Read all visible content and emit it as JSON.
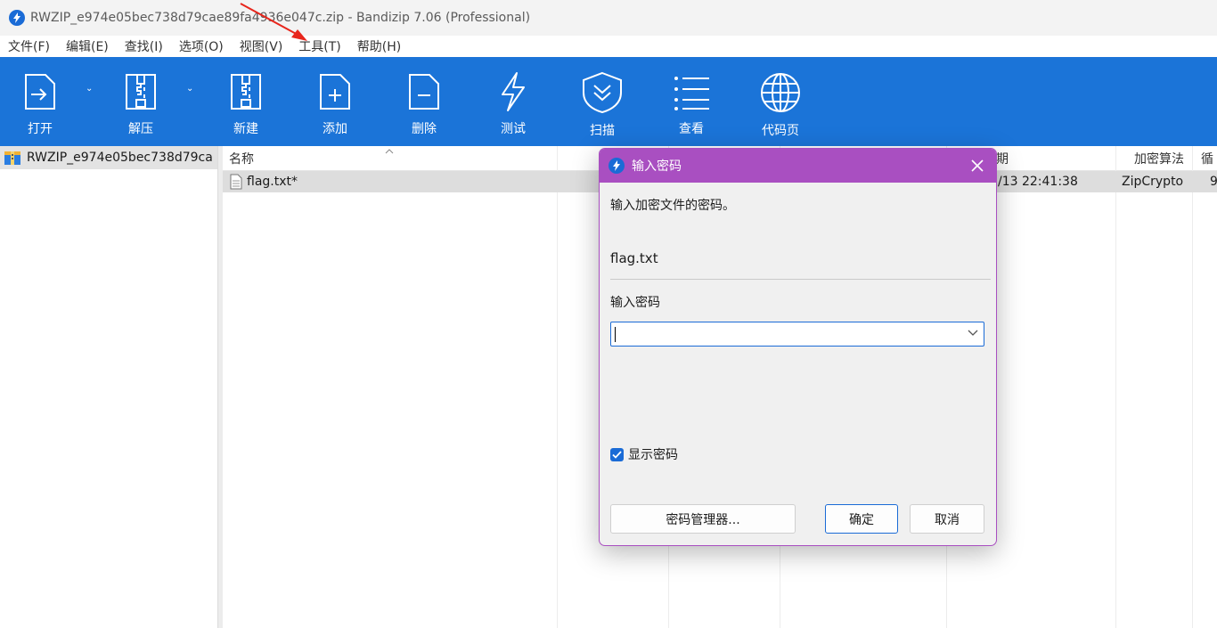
{
  "window": {
    "title": "RWZIP_e974e05bec738d79cae89fa4936e047c.zip - Bandizip 7.06 (Professional)"
  },
  "menu": [
    "文件(F)",
    "编辑(E)",
    "查找(I)",
    "选项(O)",
    "视图(V)",
    "工具(T)",
    "帮助(H)"
  ],
  "toolbar": {
    "open": "打开",
    "extract": "解压",
    "new": "新建",
    "add": "添加",
    "delete": "删除",
    "test": "测试",
    "scan": "扫描",
    "view": "查看",
    "codepage": "代码页"
  },
  "tree": {
    "root": "RWZIP_e974e05bec738d79ca"
  },
  "list": {
    "headers": {
      "name": "名称",
      "modified": "期",
      "encryption": "加密算法",
      "crc": "循"
    },
    "rows": [
      {
        "name": "flag.txt*",
        "modified": "/13 22:41:38",
        "encryption": "ZipCrypto",
        "crc": "9"
      }
    ]
  },
  "dialog": {
    "title": "输入密码",
    "description": "输入加密文件的密码。",
    "filename": "flag.txt",
    "password_label": "输入密码",
    "password_value": "",
    "show_password_label": "显示密码",
    "show_password_checked": true,
    "manager_button": "密码管理器...",
    "ok_button": "确定",
    "cancel_button": "取消"
  },
  "colors": {
    "toolbar": "#1b74d8",
    "dialog_title": "#a94fc1",
    "accent": "#1a6bd6"
  }
}
